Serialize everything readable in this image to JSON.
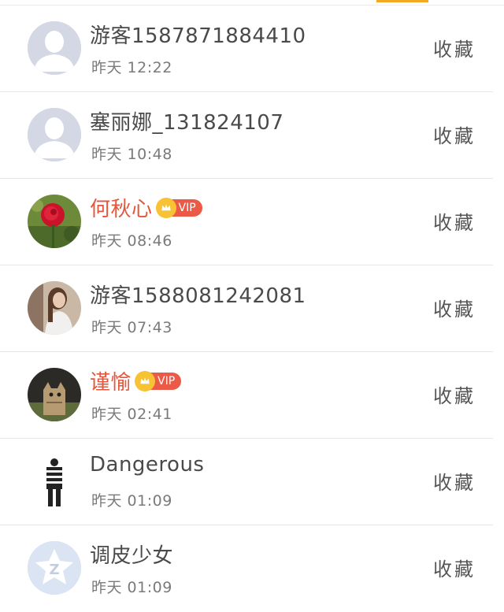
{
  "colors": {
    "accent": "#f5a623",
    "vip_name": "#e4573d",
    "vip_badge": "#ea5a46"
  },
  "rows": [
    {
      "name": "游客1587871884410",
      "time": "昨天 12:22",
      "action": "收藏",
      "vip": false,
      "avatar": "default-user-icon"
    },
    {
      "name": "塞丽娜_131824107",
      "time": "昨天 10:48",
      "action": "收藏",
      "vip": false,
      "avatar": "default-user-icon"
    },
    {
      "name": "何秋心",
      "time": "昨天 08:46",
      "action": "收藏",
      "vip": true,
      "vip_label": "VIP",
      "avatar": "rose-photo"
    },
    {
      "name": "游客1588081242081",
      "time": "昨天 07:43",
      "action": "收藏",
      "vip": false,
      "avatar": "girl-photo"
    },
    {
      "name": "谨愉",
      "time": "昨天 02:41",
      "action": "收藏",
      "vip": true,
      "vip_label": "VIP",
      "avatar": "cat-photo"
    },
    {
      "name": "Dangerous",
      "time": "昨天 01:09",
      "action": "收藏",
      "vip": false,
      "avatar": "striped-figure"
    },
    {
      "name": "调皮少女",
      "time": "昨天 01:09",
      "action": "收藏",
      "vip": false,
      "avatar": "qq-logo-icon"
    }
  ]
}
